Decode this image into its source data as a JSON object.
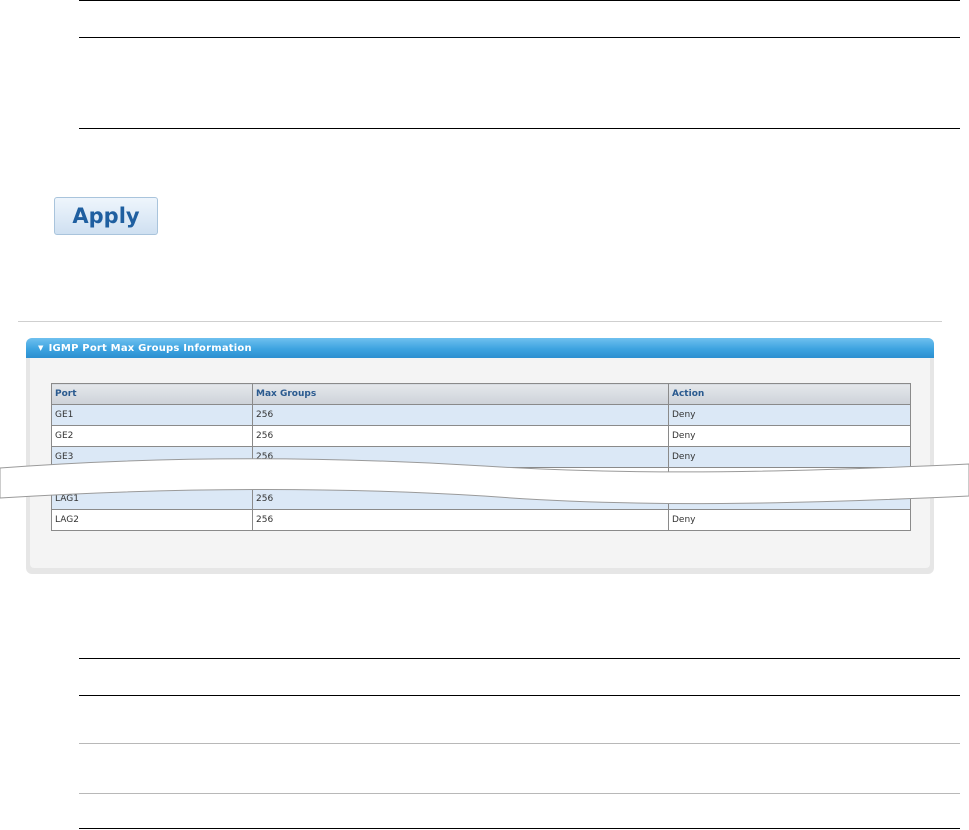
{
  "apply_button": {
    "label": "Apply"
  },
  "panel": {
    "title": "IGMP Port Max Groups Information"
  },
  "table": {
    "columns": [
      "Port",
      "Max Groups",
      "Action"
    ],
    "rows": [
      [
        "GE1",
        "256",
        "Deny"
      ],
      [
        "GE2",
        "256",
        "Deny"
      ],
      [
        "GE3",
        "256",
        "Deny"
      ],
      [
        "",
        "",
        ""
      ],
      [
        "LAG1",
        "256",
        "Deny"
      ],
      [
        "LAG2",
        "256",
        "Deny"
      ]
    ]
  }
}
